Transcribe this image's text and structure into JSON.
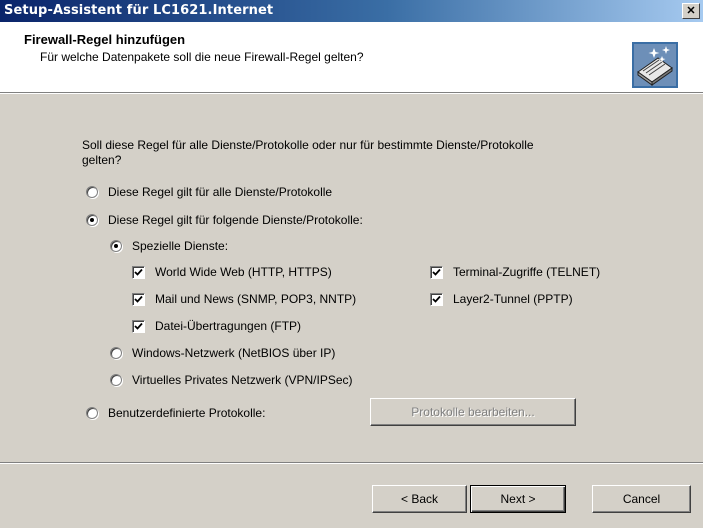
{
  "window": {
    "title": "Setup-Assistent für LC1621.Internet",
    "close_glyph": "✕"
  },
  "header": {
    "title": "Firewall-Regel hinzufügen",
    "subtitle": "Für welche Datenpakete soll die neue Firewall-Regel gelten?",
    "icon": "wizard-firewall-icon"
  },
  "question": "Soll diese Regel für alle Dienste/Protokolle oder nur für bestimmte Dienste/Protokolle gelten?",
  "scope": {
    "all_label": "Diese Regel gilt für alle Dienste/Protokolle",
    "specific_label": "Diese Regel gilt für folgende Dienste/Protokolle:",
    "selected": "specific"
  },
  "services": {
    "special_label": "Spezielle Dienste:",
    "selected": "special",
    "checkboxes": [
      {
        "label": "World Wide Web (HTTP, HTTPS)",
        "checked": true
      },
      {
        "label": "Terminal-Zugriffe (TELNET)",
        "checked": true
      },
      {
        "label": "Mail und News (SNMP, POP3, NNTP)",
        "checked": true
      },
      {
        "label": "Layer2-Tunnel (PPTP)",
        "checked": true
      },
      {
        "label": "Datei-Übertragungen (FTP)",
        "checked": true
      }
    ],
    "windows_network_label": "Windows-Netzwerk (NetBIOS über IP)",
    "vpn_label": "Virtuelles Privates Netzwerk (VPN/IPSec)"
  },
  "custom": {
    "label": "Benutzerdefinierte Protokolle:",
    "edit_button": "Protokolle bearbeiten..."
  },
  "buttons": {
    "back": "< Back",
    "next": "Next >",
    "cancel": "Cancel"
  }
}
